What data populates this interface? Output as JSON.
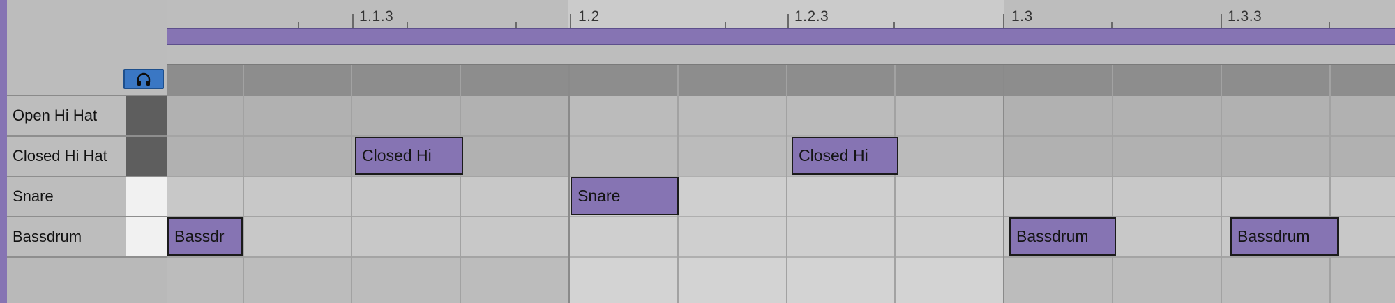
{
  "tracks": [
    {
      "name": "Open Hi Hat",
      "state": "dark"
    },
    {
      "name": "Closed Hi Hat",
      "state": "dark"
    },
    {
      "name": "Snare",
      "state": "light"
    },
    {
      "name": "Bassdrum",
      "state": "light"
    }
  ],
  "ruler": {
    "markers": [
      "1.1.3",
      "1.2",
      "1.2.3",
      "1.3",
      "1.3.3"
    ]
  },
  "preview_button": {
    "icon": "headphones-icon"
  },
  "notes": [
    {
      "label": "Closed Hi",
      "track": "Closed Hi Hat"
    },
    {
      "label": "Closed Hi",
      "track": "Closed Hi Hat"
    },
    {
      "label": "Snare",
      "track": "Snare"
    },
    {
      "label": "Bassdr",
      "track": "Bassdrum"
    },
    {
      "label": "Bassdrum",
      "track": "Bassdrum"
    },
    {
      "label": "Bassdrum",
      "track": "Bassdrum"
    }
  ],
  "colors": {
    "clip": "#8674b3",
    "accent_stripe": "#8674b3",
    "preview_button": "#3a77c4"
  }
}
